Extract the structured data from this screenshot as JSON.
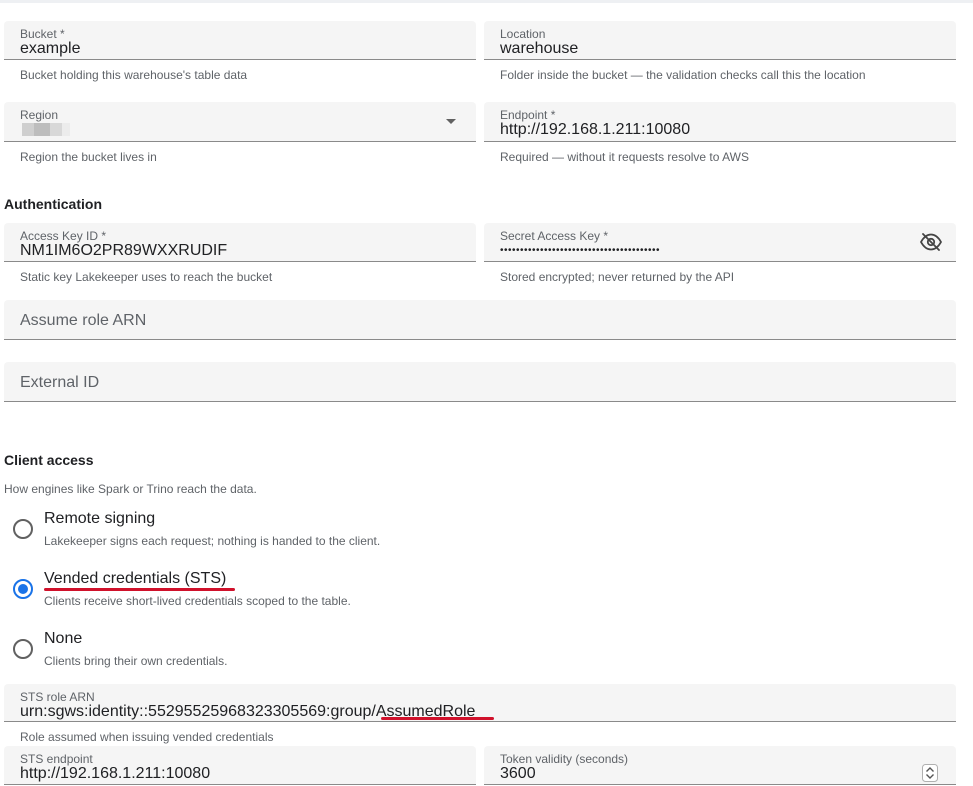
{
  "storage": {
    "bucket": {
      "label": "Bucket *",
      "value": "example",
      "hint": "Bucket holding this warehouse's table data"
    },
    "location": {
      "label": "Location",
      "value": "warehouse",
      "hint": "Folder inside the bucket — the validation checks call this the location"
    },
    "region": {
      "label": "Region",
      "hint": "Region the bucket lives in"
    },
    "endpoint": {
      "label": "Endpoint *",
      "value": "http://192.168.1.211:10080",
      "hint": "Required — without it requests resolve to AWS"
    }
  },
  "authentication": {
    "title": "Authentication",
    "access_key": {
      "label": "Access Key ID *",
      "value": "NM1IM6O2PR89WXXRUDIF",
      "hint": "Static key Lakekeeper uses to reach the bucket"
    },
    "secret_key": {
      "label": "Secret Access Key *",
      "value": "••••••••••••••••••••••••••••••••••••••••",
      "hint": "Stored encrypted; never returned by the API"
    },
    "assume_role": {
      "placeholder": "Assume role ARN"
    },
    "external_id": {
      "placeholder": "External ID"
    }
  },
  "client_access": {
    "title": "Client access",
    "description": "How engines like Spark or Trino reach the data.",
    "options": [
      {
        "title": "Remote signing",
        "description": "Lakekeeper signs each request; nothing is handed to the client.",
        "selected": false
      },
      {
        "title": "Vended credentials (STS)",
        "description": "Clients receive short-lived credentials scoped to the table.",
        "selected": true
      },
      {
        "title": "None",
        "description": "Clients bring their own credentials.",
        "selected": false
      }
    ],
    "sts_role": {
      "label": "STS role ARN",
      "value": "urn:sgws:identity::55295525968323305569:group/AssumedRole",
      "hint": "Role assumed when issuing vended credentials"
    },
    "sts_endpoint": {
      "label": "STS endpoint",
      "value": "http://192.168.1.211:10080"
    },
    "token_validity": {
      "label": "Token validity (seconds)",
      "value": "3600"
    }
  },
  "icons": {
    "region_dropdown": "caret-down-icon",
    "secret_toggle": "eye-off-icon",
    "token_spinner": "spinner-arrows-icon"
  },
  "colors": {
    "selected_radio": "#1a73e8",
    "annotation": "#d0112b"
  }
}
